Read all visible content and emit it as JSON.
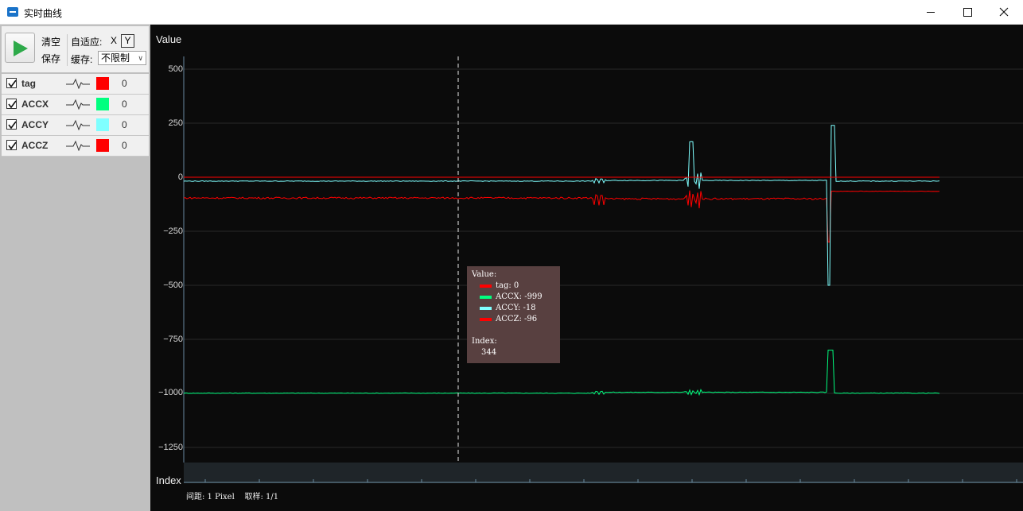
{
  "window": {
    "title": "实时曲线"
  },
  "toolbar": {
    "clear_label": "清空",
    "save_label": "保存",
    "adaptive_label": "自适应:",
    "x_label": "X",
    "y_label": "Y",
    "cache_label": "缓存:",
    "cache_value": "不限制"
  },
  "channels": [
    {
      "name": "tag",
      "checked": true,
      "color": "#ff0000",
      "value": "0"
    },
    {
      "name": "ACCX",
      "checked": true,
      "color": "#00ff7f",
      "value": "0"
    },
    {
      "name": "ACCY",
      "checked": true,
      "color": "#7fffff",
      "value": "0"
    },
    {
      "name": "ACCZ",
      "checked": true,
      "color": "#ff0000",
      "value": "0"
    }
  ],
  "plot": {
    "y_axis_title": "Value",
    "x_axis_title": "Index",
    "y_ticks": [
      "500",
      "250",
      "0",
      "−250",
      "−500",
      "−750",
      "−1000",
      "−1250"
    ],
    "background": "#0b0b0b"
  },
  "tooltip": {
    "title": "Value:",
    "entries": [
      {
        "label": "tag: 0",
        "color": "#ff0000"
      },
      {
        "label": "ACCX: -999",
        "color": "#00ff7f"
      },
      {
        "label": "ACCY: -18",
        "color": "#7fffff"
      },
      {
        "label": "ACCZ: -96",
        "color": "#ff0000"
      }
    ],
    "index_label": "Index:",
    "index_value": "344"
  },
  "status": {
    "spacing": "间距: 1 Pixel",
    "sampling": "取样: 1/1"
  },
  "chart_data": {
    "type": "line",
    "title": "",
    "ylabel": "Value",
    "xlabel": "Index",
    "ylim": [
      -1300,
      560
    ],
    "grid": true,
    "series": [
      {
        "name": "tag",
        "color": "#ff0000",
        "values": [
          0,
          0,
          0,
          0,
          0,
          0
        ]
      },
      {
        "name": "ACCX",
        "color": "#00ff7f",
        "values": [
          -999,
          -999,
          -995,
          -985,
          -999,
          -999
        ]
      },
      {
        "name": "ACCY",
        "color": "#7fffff",
        "values": [
          -18,
          -18,
          -15,
          170,
          240,
          -18
        ]
      },
      {
        "name": "ACCZ",
        "color": "#ff0000",
        "values": [
          -96,
          -96,
          -100,
          -75,
          -65,
          -65
        ]
      }
    ]
  }
}
